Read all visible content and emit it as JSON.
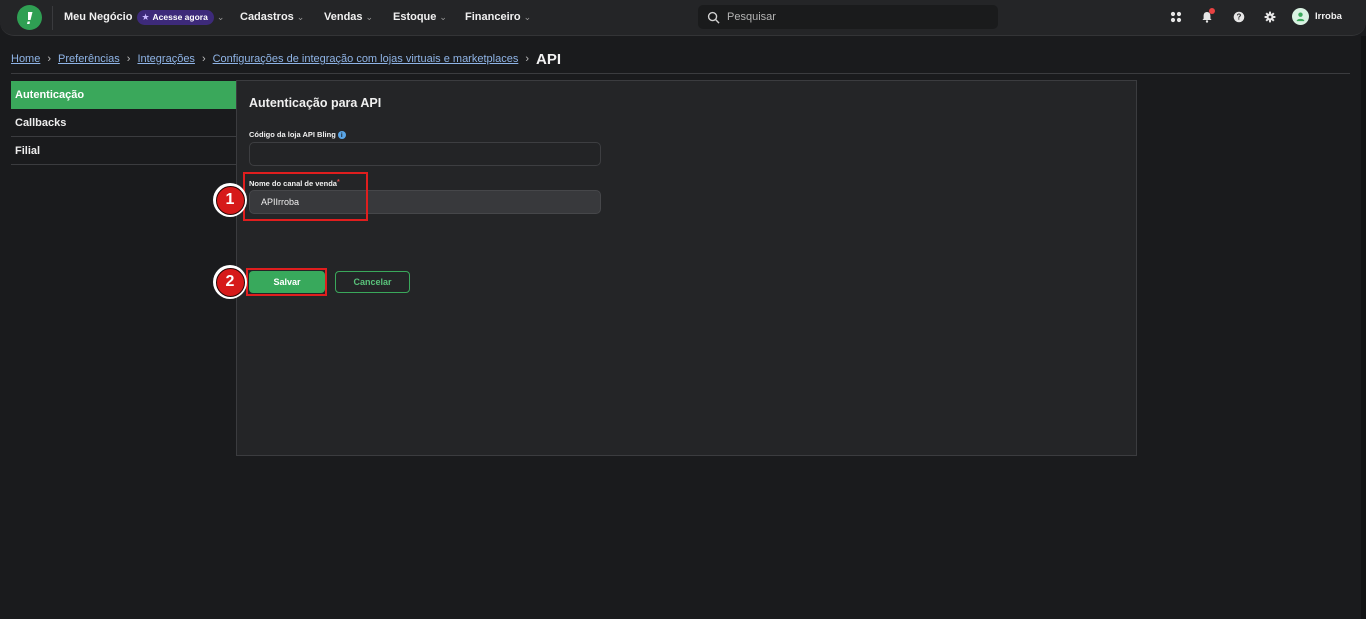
{
  "topbar": {
    "nav": {
      "meu_negocio": "Meu Negócio",
      "badge": "Acesse agora",
      "cadastros": "Cadastros",
      "vendas": "Vendas",
      "estoque": "Estoque",
      "financeiro": "Financeiro"
    },
    "search_placeholder": "Pesquisar",
    "username": "Irroba"
  },
  "breadcrumb": {
    "items": [
      "Home",
      "Preferências",
      "Integrações",
      "Configurações de integração com lojas virtuais e marketplaces"
    ],
    "current": "API"
  },
  "sidebar": {
    "items": [
      {
        "label": "Autenticação",
        "active": true
      },
      {
        "label": "Callbacks",
        "active": false
      },
      {
        "label": "Filial",
        "active": false
      }
    ]
  },
  "panel": {
    "title": "Autenticação para API",
    "fields": {
      "store_code_label": "Código da loja API Bling",
      "store_code_value": "",
      "channel_name_label": "Nome do canal de venda",
      "channel_name_required": "*",
      "channel_name_value": "APIIrroba"
    },
    "buttons": {
      "save": "Salvar",
      "cancel": "Cancelar"
    }
  },
  "annotations": {
    "step1": "1",
    "step2": "2"
  },
  "colors": {
    "accent_green": "#3aa85b",
    "annotation_red": "#d61a1a",
    "background": "#1a1b1d",
    "panel": "#242527"
  }
}
